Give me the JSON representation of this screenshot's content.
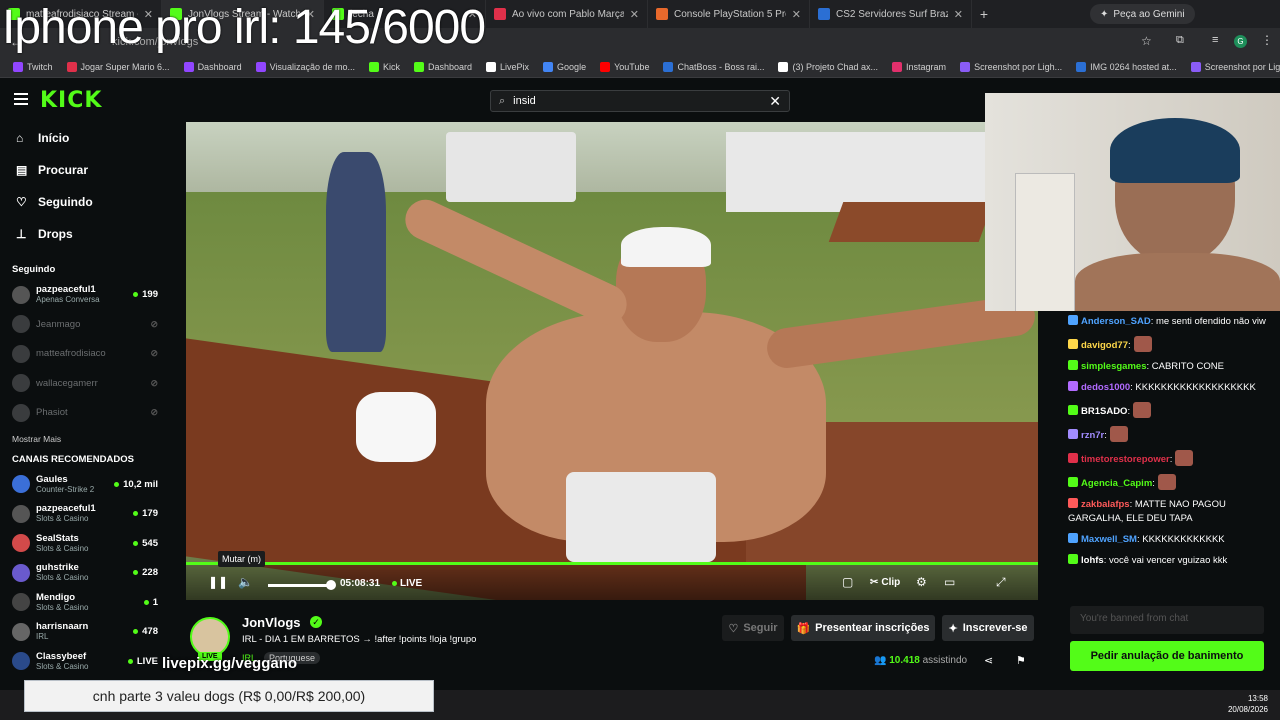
{
  "overlay": {
    "title": "Iphone pro irl: 145/6000",
    "livepix_handle": "livepix.gg/veggano",
    "donation_goal": "cnh parte 3 valeu dogs (R$ 0,00/R$ 200,00)"
  },
  "browser": {
    "tabs": [
      {
        "label": "matteafrodisiaco Stream - Watc",
        "color": "#53fc18"
      },
      {
        "label": "JonVlogs Stream - Watch Li",
        "color": "#53fc18"
      },
      {
        "label": "lecha",
        "color": "#53fc18"
      },
      {
        "label": "Ao vivo com Pablo Marçal e Dr",
        "color": "#e0304a"
      },
      {
        "label": "Console PlayStation 5 Pro Sony",
        "color": "#e8692c"
      },
      {
        "label": "CS2 Servidores Surf Brazil - xpla",
        "color": "#2b6fd4"
      }
    ],
    "gemini_label": "Peça ao Gemini",
    "url": "kick.com/jonvlogs",
    "bookmarks": [
      "Twitch",
      "Jogar Super Mario 6...",
      "Dashboard",
      "Visualização de mo...",
      "Kick",
      "Dashboard",
      "LivePix",
      "Google",
      "YouTube",
      "ChatBoss - Boss rai...",
      "(3) Projeto Chad ax...",
      "Instagram",
      "Screenshot por Ligh...",
      "IMG 0264 hosted at...",
      "Screenshot por Ligh..."
    ]
  },
  "header": {
    "logo": "KICK",
    "search_value": "insid"
  },
  "sidebar": {
    "nav": [
      {
        "label": "Início",
        "icon": "home-icon",
        "glyph": "⌂"
      },
      {
        "label": "Procurar",
        "icon": "browse-icon",
        "glyph": "▤"
      },
      {
        "label": "Seguindo",
        "icon": "heart-icon",
        "glyph": "♡"
      },
      {
        "label": "Drops",
        "icon": "drops-icon",
        "glyph": "⊥"
      }
    ],
    "following_title": "Seguindo",
    "following": [
      {
        "name": "pazpeaceful1",
        "sub": "Apenas Conversa",
        "count": "199",
        "live": true
      },
      {
        "name": "Jeanmago",
        "sub": "",
        "count": "",
        "live": false
      },
      {
        "name": "matteafrodisiaco",
        "sub": "",
        "count": "",
        "live": false
      },
      {
        "name": "wallacegamerr",
        "sub": "",
        "count": "",
        "live": false
      },
      {
        "name": "Phasiot",
        "sub": "",
        "count": "",
        "live": false
      }
    ],
    "show_more": "Mostrar Mais",
    "recommended_title": "CANAIS RECOMENDADOS",
    "recommended": [
      {
        "name": "Gaules",
        "sub": "Counter-Strike 2",
        "count": "10,2 mil"
      },
      {
        "name": "pazpeaceful1",
        "sub": "Slots & Casino",
        "count": "179"
      },
      {
        "name": "SealStats",
        "sub": "Slots & Casino",
        "count": "545"
      },
      {
        "name": "guhstrike",
        "sub": "Slots & Casino",
        "count": "228"
      },
      {
        "name": "Mendigo",
        "sub": "Slots & Casino",
        "count": "1"
      },
      {
        "name": "harrisnaarn",
        "sub": "IRL",
        "count": "478"
      },
      {
        "name": "Classybeef",
        "sub": "Slots & Casino",
        "count": "LIVE"
      }
    ]
  },
  "player": {
    "tooltip": "Mutar (m)",
    "time": "05:08:31",
    "live_label": "LIVE",
    "clip_label": "Clip",
    "volume_fraction": 0.9
  },
  "channel": {
    "name": "JonVlogs",
    "stream_title": "IRL - DIA 1 EM BARRETOS → !after !points !loja !grupo",
    "category": "IRL",
    "language": "Portuguese",
    "live_badge": "LIVE",
    "follow_label": "Seguir",
    "gift_label": "Presentear inscrições",
    "subscribe_label": "Inscrever-se",
    "viewers": "10.418",
    "viewers_label": "assistindo"
  },
  "chat": {
    "messages": [
      {
        "user": "Anderson_SAD",
        "color": "#4fa3ff",
        "text": ": me senti ofendido não viw",
        "emote": false
      },
      {
        "user": "davigod77",
        "color": "#ffd84a",
        "text": ":",
        "emote": true
      },
      {
        "user": "simplesgames",
        "color": "#53fc18",
        "text": ": CABRITO CONE",
        "emote": false
      },
      {
        "user": "dedos1000",
        "color": "#b26bff",
        "text": ": KKKKKKKKKKKKKKKKKKK",
        "emote": false
      },
      {
        "user": "BR1SADO",
        "color": "#ffffff",
        "text": ":",
        "emote": true
      },
      {
        "user": "rzn7r",
        "color": "#a28cff",
        "text": ":",
        "emote": true
      },
      {
        "user": "timetorestorepower",
        "color": "#e0304a",
        "text": ":",
        "emote": true
      },
      {
        "user": "Agencia_Capim",
        "color": "#53fc18",
        "text": ":",
        "emote": true
      },
      {
        "user": "zakbalafps",
        "color": "#ff5a5a",
        "text": ": MATTE NAO PAGOU GARGALHA, ELE DEU TAPA",
        "emote": false
      },
      {
        "user": "Maxwell_SM",
        "color": "#4fa3ff",
        "text": ": KKKKKKKKKKKKK",
        "emote": false
      },
      {
        "user": "lohfs",
        "color": "#ffffff",
        "text": ": você vai vencer vguizao kkk",
        "emote": false
      }
    ],
    "input_placeholder": "You're banned from chat",
    "unban_label": "Pedir anulação de banimento"
  },
  "taskbar": {
    "time": "13:58",
    "date": "20/08/2026"
  }
}
